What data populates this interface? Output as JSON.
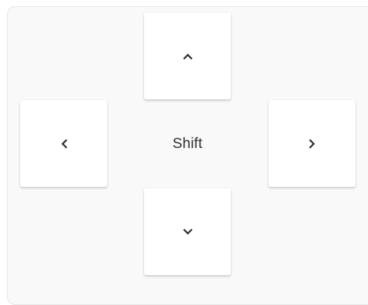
{
  "center": {
    "label": "Shift"
  },
  "keys": [
    {
      "direction": "up",
      "icon": "chevron-up-icon"
    },
    {
      "direction": "left",
      "icon": "chevron-left-icon"
    },
    {
      "direction": "right",
      "icon": "chevron-right-icon"
    },
    {
      "direction": "down",
      "icon": "chevron-down-icon"
    }
  ],
  "colors": {
    "panel_background": "#f9f9f9",
    "key_background": "#ffffff",
    "glyph": "#2f2f2f"
  }
}
